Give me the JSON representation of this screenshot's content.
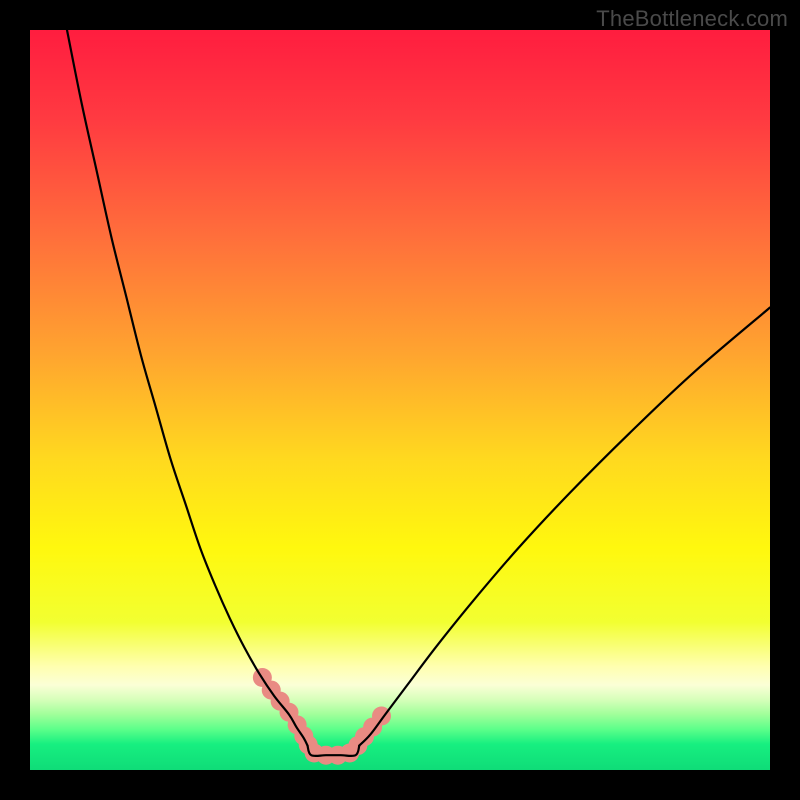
{
  "watermark": "TheBottleneck.com",
  "chart_data": {
    "type": "line",
    "title": "",
    "xlabel": "",
    "ylabel": "",
    "xlim": [
      0,
      100
    ],
    "ylim": [
      0,
      100
    ],
    "series": [
      {
        "name": "left-curve",
        "x": [
          5,
          7,
          9,
          11,
          13,
          15,
          17,
          19,
          21,
          23,
          25,
          27,
          29,
          31,
          33,
          35,
          36,
          37,
          37.5
        ],
        "values": [
          100,
          90,
          81,
          72,
          64,
          56,
          49,
          42,
          36,
          30,
          25,
          20.5,
          16.5,
          13,
          10,
          7.5,
          5.8,
          4.3,
          3.3
        ]
      },
      {
        "name": "right-curve",
        "x": [
          44.5,
          46,
          48,
          51,
          55,
          60,
          66,
          73,
          81,
          90,
          100
        ],
        "values": [
          3.3,
          4.8,
          7.5,
          11.5,
          16.8,
          23,
          30,
          37.5,
          45.5,
          54,
          62.5
        ]
      },
      {
        "name": "bottom-flat",
        "x": [
          37.5,
          38,
          40,
          42,
          44,
          44.5
        ],
        "values": [
          3.3,
          2.0,
          2.0,
          2.0,
          2.0,
          3.3
        ]
      }
    ],
    "markers": {
      "name": "highlight-dots",
      "color": "#e98b83",
      "points_x": [
        31.4,
        32.6,
        33.8,
        35.0,
        36.1,
        37.0,
        37.6,
        38.4,
        40.0,
        41.6,
        43.2,
        44.3,
        45.2,
        46.3,
        47.5
      ],
      "points_y": [
        12.5,
        10.8,
        9.3,
        7.8,
        6.1,
        4.6,
        3.4,
        2.3,
        2.0,
        2.0,
        2.3,
        3.3,
        4.5,
        5.8,
        7.3
      ]
    },
    "gradient_stops": [
      {
        "offset": 0.0,
        "color": "#ff1d3f"
      },
      {
        "offset": 0.12,
        "color": "#ff3a41"
      },
      {
        "offset": 0.28,
        "color": "#ff6f3b"
      },
      {
        "offset": 0.44,
        "color": "#ffa52f"
      },
      {
        "offset": 0.58,
        "color": "#ffd91f"
      },
      {
        "offset": 0.7,
        "color": "#fff80e"
      },
      {
        "offset": 0.8,
        "color": "#f2ff31"
      },
      {
        "offset": 0.86,
        "color": "#ffffb0"
      },
      {
        "offset": 0.885,
        "color": "#fbffd6"
      },
      {
        "offset": 0.905,
        "color": "#d6ffba"
      },
      {
        "offset": 0.925,
        "color": "#a0ff9a"
      },
      {
        "offset": 0.945,
        "color": "#5cff8a"
      },
      {
        "offset": 0.965,
        "color": "#17ef80"
      },
      {
        "offset": 1.0,
        "color": "#0fdc78"
      }
    ]
  }
}
